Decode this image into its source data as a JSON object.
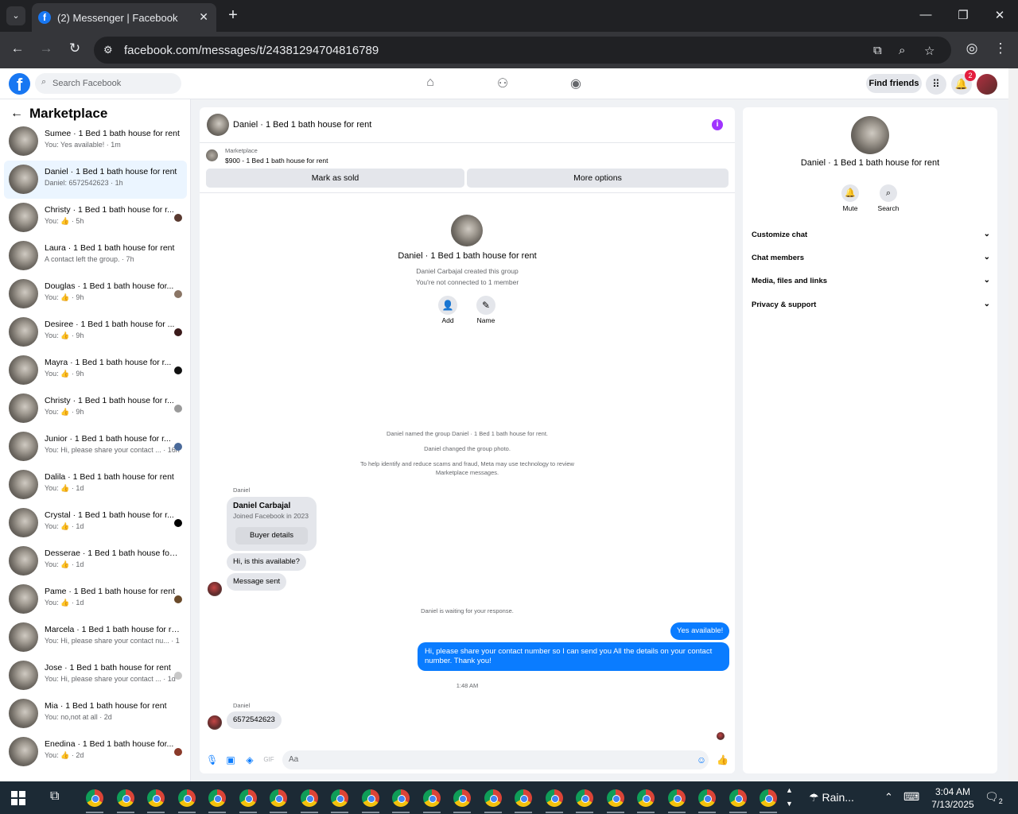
{
  "browser": {
    "tab_title": "(2) Messenger | Facebook",
    "url": "facebook.com/messages/t/24381294704816789"
  },
  "fb": {
    "search_placeholder": "Search Facebook",
    "find_friends": "Find friends",
    "notif_count": "2"
  },
  "left": {
    "title": "Marketplace",
    "conversations": [
      {
        "name": "Sumee · 1 Bed 1 bath house for rent",
        "sub": "You: Yes available! · 1m",
        "mini": ""
      },
      {
        "name": "Daniel · 1 Bed 1 bath house for rent",
        "sub": "Daniel: 6572542623 · 1h",
        "mini": ""
      },
      {
        "name": "Christy · 1 Bed 1 bath house for r...",
        "sub": "You: 👍 · 5h",
        "mini": "#5a3a30"
      },
      {
        "name": "Laura · 1 Bed 1 bath house for rent",
        "sub": "A contact left the group. · 7h",
        "mini": ""
      },
      {
        "name": "Douglas · 1 Bed 1 bath house for...",
        "sub": "You: 👍 · 9h",
        "mini": "#8a7565"
      },
      {
        "name": "Desiree · 1 Bed 1 bath house for ...",
        "sub": "You: 👍 · 9h",
        "mini": "#3a1a1a"
      },
      {
        "name": "Mayra · 1 Bed 1 bath house for r...",
        "sub": "You: 👍 · 9h",
        "mini": "#111111"
      },
      {
        "name": "Christy · 1 Bed 1 bath house for r...",
        "sub": "You: 👍 · 9h",
        "mini": "#9a9a9a"
      },
      {
        "name": "Junior · 1 Bed 1 bath house for r...",
        "sub": "You: Hi, please share your contact ... · 16h",
        "mini": "#4a6a9a"
      },
      {
        "name": "Dalila · 1 Bed 1 bath house for rent",
        "sub": "You: 👍 · 1d",
        "mini": ""
      },
      {
        "name": "Crystal · 1 Bed 1 bath house for r...",
        "sub": "You: 👍 · 1d",
        "mini": "#000000"
      },
      {
        "name": "Desserae · 1 Bed 1 bath house for r...",
        "sub": "You: 👍 · 1d",
        "mini": ""
      },
      {
        "name": "Pame · 1 Bed 1 bath house for rent",
        "sub": "You: 👍 · 1d",
        "mini": "#6a4a2a"
      },
      {
        "name": "Marcela · 1 Bed 1 bath house for rent",
        "sub": "You: Hi, please share your contact nu... · 1d",
        "mini": ""
      },
      {
        "name": "Jose · 1 Bed 1 bath house for rent",
        "sub": "You: Hi, please share your contact ... · 1d",
        "mini": "#c8c8c8"
      },
      {
        "name": "Mia · 1 Bed 1 bath house for rent",
        "sub": "You: no,not at all · 2d",
        "mini": ""
      },
      {
        "name": "Enedina · 1 Bed 1 bath house for...",
        "sub": "You: 👍 · 2d",
        "mini": "#8a3a2a"
      }
    ]
  },
  "chat": {
    "title": "Daniel · 1 Bed 1 bath house for rent",
    "marketplace_label": "Marketplace",
    "price_line": "$900 - 1 Bed 1 bath house for rent",
    "mark_sold": "Mark as sold",
    "more_options": "More options",
    "group_name": "Daniel · 1 Bed 1 bath house for rent",
    "created_by": "Daniel Carbajal created this group",
    "not_connected": "You're not connected to 1 member",
    "add_label": "Add",
    "name_label": "Name",
    "sys1": "Daniel named the group Daniel · 1 Bed 1 bath house for rent.",
    "sys2": "Daniel changed the group photo.",
    "sys3a": "To help identify and reduce scams and fraud, Meta may use technology to review",
    "sys3b": "Marketplace messages.",
    "sender1": "Daniel",
    "card_name": "Daniel Carbajal",
    "card_sub": "Joined Facebook in 2023",
    "buyer_details": "Buyer details",
    "msg1": "Hi, is this available?",
    "msg2": "Message sent",
    "waiting": "Daniel is waiting for your response.",
    "me1": "Yes available!",
    "me2": "Hi, please share your contact number so I can send you All the details on your contact number. Thank you!",
    "time": "1:48 AM",
    "sender2": "Daniel",
    "msg3": "6572542623",
    "composer_placeholder": "Aa"
  },
  "right": {
    "name": "Daniel · 1 Bed 1 bath house for rent",
    "mute": "Mute",
    "search": "Search",
    "sections": [
      "Customize chat",
      "Chat members",
      "Media, files and links",
      "Privacy & support"
    ]
  },
  "taskbar": {
    "weather": "Rain...",
    "time": "3:04 AM",
    "date": "7/13/2025",
    "notif_count": "2"
  },
  "colors": {
    "accent": "#0a7cff",
    "fb_blue": "#1877f2",
    "info_purple": "#a033ff"
  }
}
